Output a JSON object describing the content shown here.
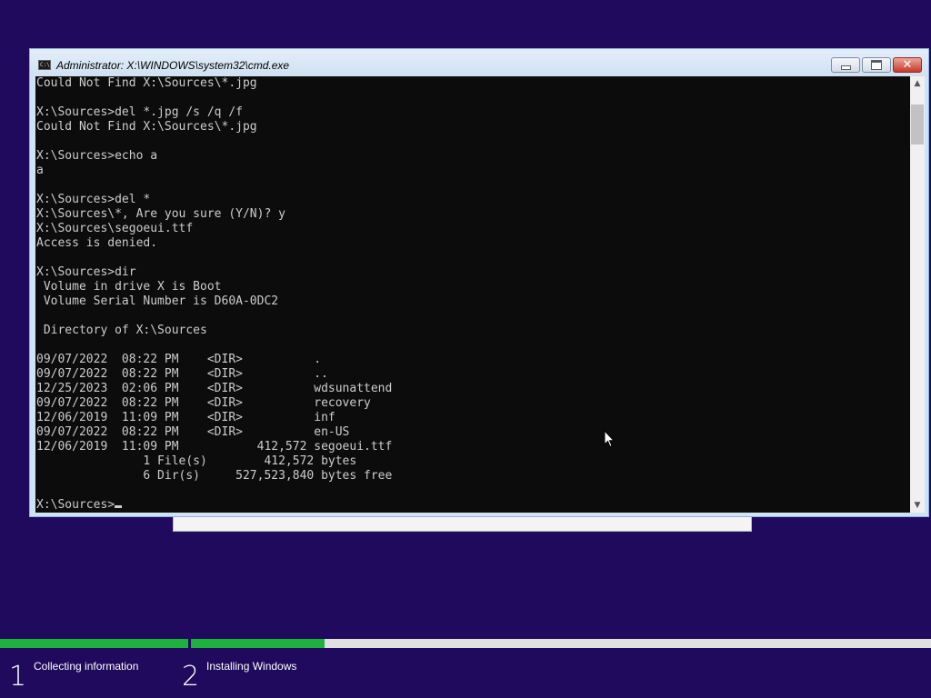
{
  "window": {
    "title": "Administrator: X:\\WINDOWS\\system32\\cmd.exe",
    "icon_label": "C:\\",
    "close_glyph": "✕"
  },
  "console": {
    "lines": [
      "Could Not Find X:\\Sources\\*.jpg",
      "",
      "X:\\Sources>del *.jpg /s /q /f",
      "Could Not Find X:\\Sources\\*.jpg",
      "",
      "X:\\Sources>echo a",
      "a",
      "",
      "X:\\Sources>del *",
      "X:\\Sources\\*, Are you sure (Y/N)? y",
      "X:\\Sources\\segoeui.ttf",
      "Access is denied.",
      "",
      "X:\\Sources>dir",
      " Volume in drive X is Boot",
      " Volume Serial Number is D60A-0DC2",
      "",
      " Directory of X:\\Sources",
      "",
      "09/07/2022  08:22 PM    <DIR>          .",
      "09/07/2022  08:22 PM    <DIR>          ..",
      "12/25/2023  02:06 PM    <DIR>          wdsunattend",
      "09/07/2022  08:22 PM    <DIR>          recovery",
      "12/06/2019  11:09 PM    <DIR>          inf",
      "09/07/2022  08:22 PM    <DIR>          en-US",
      "12/06/2019  11:09 PM           412,572 segoeui.ttf",
      "               1 File(s)        412,572 bytes",
      "               6 Dir(s)     527,523,840 bytes free",
      ""
    ],
    "prompt": "X:\\Sources>"
  },
  "scrollbar": {
    "up_glyph": "▲",
    "down_glyph": "▼"
  },
  "setup": {
    "progress": {
      "step1_fraction": 1.0,
      "step2_fraction": 0.18
    },
    "steps": [
      {
        "number": "1",
        "label": "Collecting information"
      },
      {
        "number": "2",
        "label": "Installing Windows"
      }
    ]
  }
}
